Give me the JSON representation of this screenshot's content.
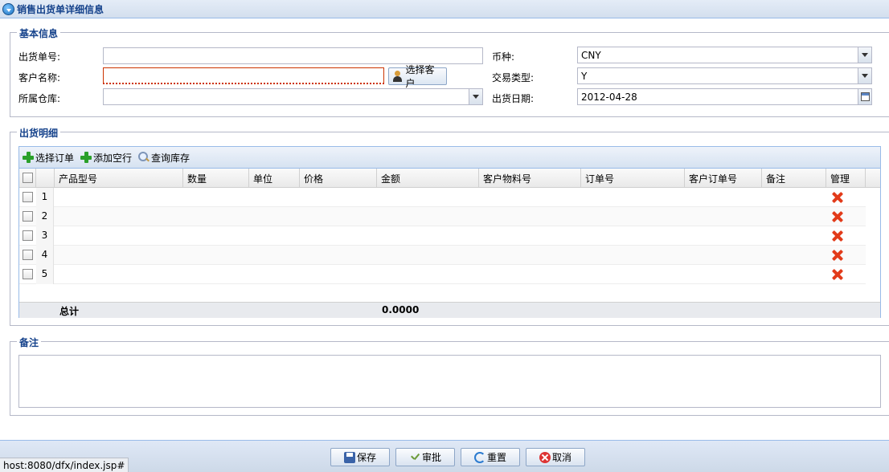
{
  "window": {
    "title": "销售出货单详细信息"
  },
  "basic_info": {
    "legend": "基本信息",
    "fields": {
      "shipment_no": {
        "label": "出货单号:",
        "value": ""
      },
      "customer_name": {
        "label": "客户名称:",
        "value": ""
      },
      "select_customer_button": "选择客户",
      "warehouse": {
        "label": "所属仓库:",
        "value": ""
      },
      "currency": {
        "label": "币种:",
        "value": "CNY"
      },
      "trade_type": {
        "label": "交易类型:",
        "value": "Y"
      },
      "ship_date": {
        "label": "出货日期:",
        "value": "2012-04-28"
      }
    }
  },
  "detail": {
    "legend": "出货明细",
    "toolbar": {
      "select_order": "选择订单",
      "add_row": "添加空行",
      "query_stock": "查询库存"
    },
    "columns": [
      "产品型号",
      "数量",
      "单位",
      "价格",
      "金额",
      "客户物料号",
      "订单号",
      "客户订单号",
      "备注",
      "管理"
    ],
    "rows": [
      {
        "num": "1"
      },
      {
        "num": "2"
      },
      {
        "num": "3"
      },
      {
        "num": "4"
      },
      {
        "num": "5"
      }
    ],
    "summary": {
      "label": "总计",
      "amount": "0.0000"
    }
  },
  "remarks": {
    "legend": "备注",
    "value": ""
  },
  "footer": {
    "save": "保存",
    "approve": "审批",
    "reset": "重置",
    "cancel": "取消"
  },
  "status_bar": "host:8080/dfx/index.jsp#"
}
